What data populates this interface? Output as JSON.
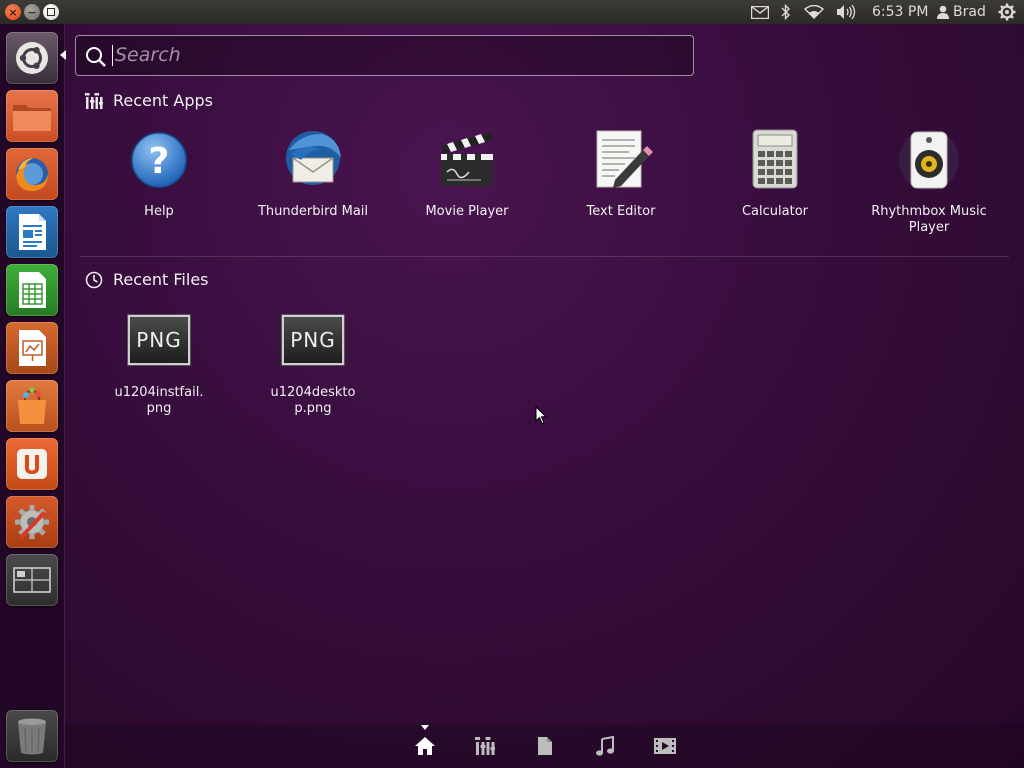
{
  "top_panel": {
    "clock": "6:53 PM",
    "user": "Brad",
    "icons": [
      "mail-icon",
      "bluetooth-icon",
      "wifi-icon",
      "volume-icon",
      "session-gear-icon"
    ]
  },
  "launcher": {
    "items": [
      {
        "name": "dash-home",
        "icon": "ubuntu-logo-icon"
      },
      {
        "name": "home-folder",
        "icon": "folder-icon"
      },
      {
        "name": "firefox",
        "icon": "firefox-icon"
      },
      {
        "name": "libreoffice-writer",
        "icon": "writer-icon"
      },
      {
        "name": "libreoffice-calc",
        "icon": "calc-icon"
      },
      {
        "name": "libreoffice-impress",
        "icon": "impress-icon"
      },
      {
        "name": "software-center",
        "icon": "shopping-bag-icon"
      },
      {
        "name": "ubuntu-one",
        "icon": "ubuntu-one-icon"
      },
      {
        "name": "system-settings",
        "icon": "settings-icon"
      },
      {
        "name": "workspace-switcher",
        "icon": "workspaces-icon"
      },
      {
        "name": "trash",
        "icon": "trash-icon"
      }
    ]
  },
  "search": {
    "placeholder": "Search"
  },
  "recent_apps": {
    "title": "Recent Apps",
    "items": [
      {
        "label": "Help",
        "icon": "help-icon"
      },
      {
        "label": "Thunderbird Mail",
        "icon": "thunderbird-icon"
      },
      {
        "label": "Movie Player",
        "icon": "clapperboard-icon"
      },
      {
        "label": "Text Editor",
        "icon": "text-editor-icon"
      },
      {
        "label": "Calculator",
        "icon": "calculator-icon"
      },
      {
        "label": "Rhythmbox Music Player",
        "icon": "rhythmbox-icon"
      }
    ]
  },
  "recent_files": {
    "title": "Recent Files",
    "items": [
      {
        "label": "u1204instfail.png",
        "icon": "png-file-icon",
        "badge": "PNG"
      },
      {
        "label": "u1204desktop.png",
        "icon": "png-file-icon",
        "badge": "PNG"
      }
    ]
  },
  "lens_bar": {
    "lenses": [
      "home-lens-icon",
      "applications-lens-icon",
      "files-lens-icon",
      "music-lens-icon",
      "video-lens-icon"
    ],
    "active": "home-lens-icon"
  },
  "colors": {
    "accent_orange": "#dd4814",
    "dash_purple": "#360d3c"
  }
}
